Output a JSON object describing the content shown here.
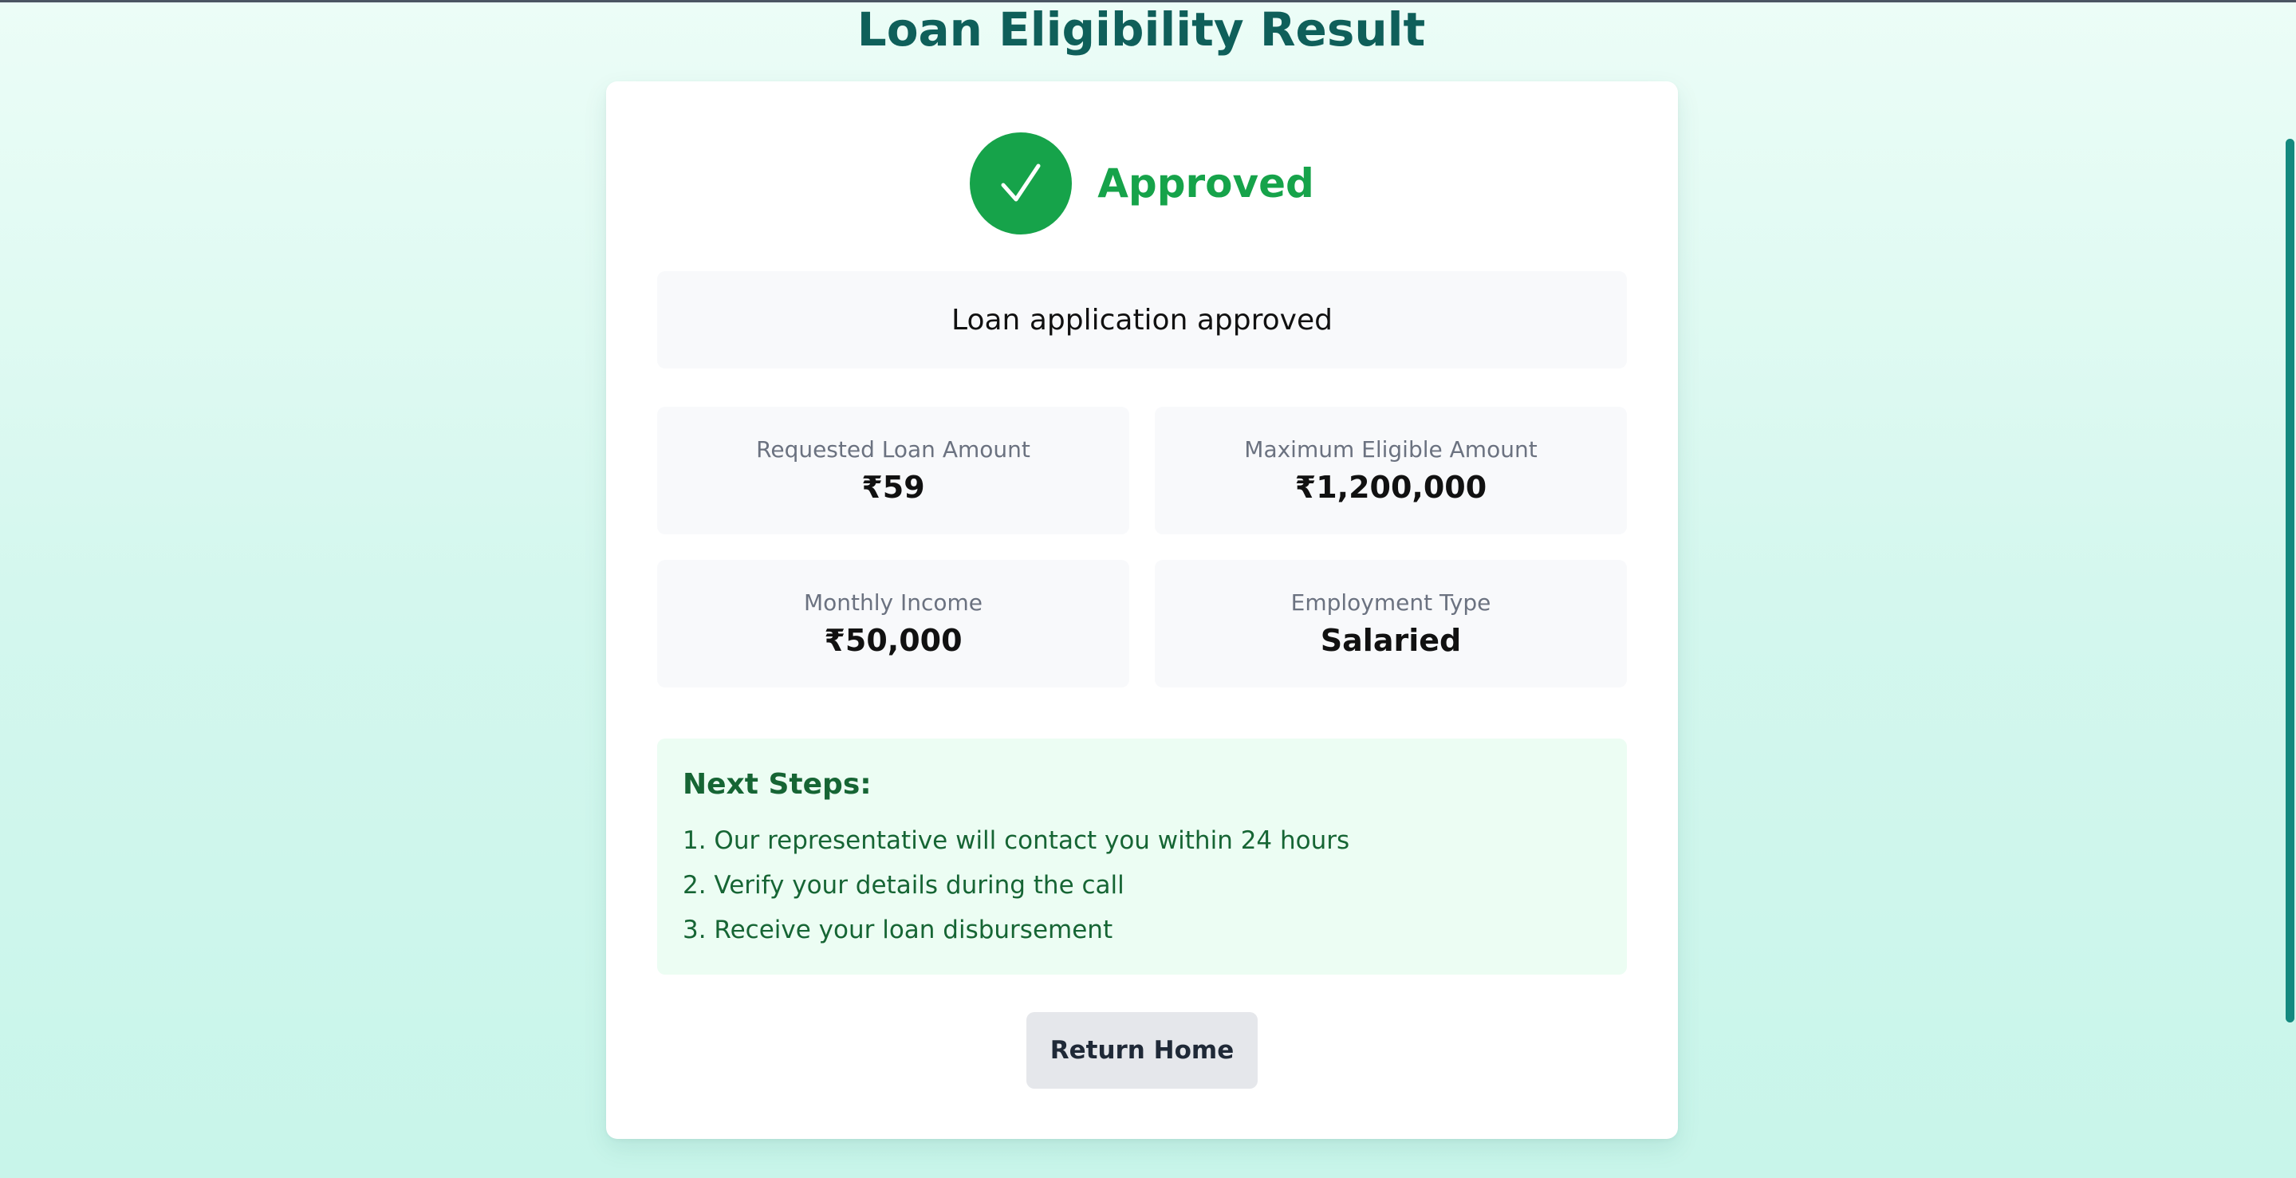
{
  "page": {
    "title": "Loan Eligibility Result"
  },
  "result": {
    "status_icon": "checkmark-icon",
    "status_label": "Approved",
    "message": "Loan application approved"
  },
  "stats": [
    {
      "label": "Requested Loan Amount",
      "value": "₹59"
    },
    {
      "label": "Maximum Eligible Amount",
      "value": "₹1,200,000"
    },
    {
      "label": "Monthly Income",
      "value": "₹50,000"
    },
    {
      "label": "Employment Type",
      "value": "Salaried"
    }
  ],
  "next_steps": {
    "title": "Next Steps:",
    "items": [
      "1. Our representative will contact you within 24 hours",
      "2. Verify your details during the call",
      "3. Receive your loan disbursement"
    ]
  },
  "actions": {
    "return_home_label": "Return Home"
  },
  "colors": {
    "title": "#0f5f5a",
    "approved": "#16a34a",
    "next_steps_text": "#166534",
    "next_steps_bg": "#ecfdf3",
    "scrollbar": "#14897f"
  }
}
